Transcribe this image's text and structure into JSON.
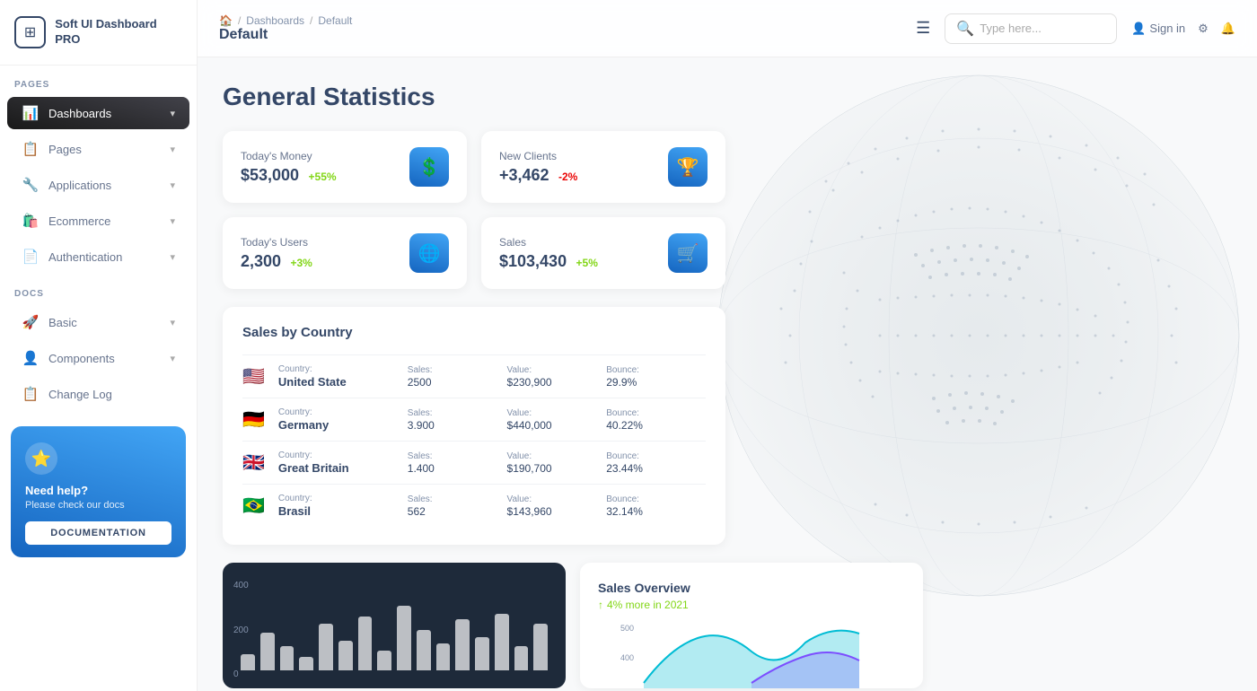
{
  "app": {
    "name": "Soft UI Dashboard PRO",
    "logo_symbol": "⊞"
  },
  "sidebar": {
    "sections": [
      {
        "label": "PAGES",
        "items": [
          {
            "id": "dashboards",
            "label": "Dashboards",
            "icon": "📊",
            "active": true,
            "has_arrow": true
          },
          {
            "id": "pages",
            "label": "Pages",
            "icon": "📋",
            "active": false,
            "has_arrow": true
          },
          {
            "id": "applications",
            "label": "Applications",
            "icon": "🔧",
            "active": false,
            "has_arrow": true
          },
          {
            "id": "ecommerce",
            "label": "Ecommerce",
            "icon": "🛍️",
            "active": false,
            "has_arrow": true
          },
          {
            "id": "authentication",
            "label": "Authentication",
            "icon": "📄",
            "active": false,
            "has_arrow": true
          }
        ]
      },
      {
        "label": "DOCS",
        "items": [
          {
            "id": "basic",
            "label": "Basic",
            "icon": "🚀",
            "active": false,
            "has_arrow": true
          },
          {
            "id": "components",
            "label": "Components",
            "icon": "👤",
            "active": false,
            "has_arrow": true
          },
          {
            "id": "changelog",
            "label": "Change Log",
            "icon": "📋",
            "active": false,
            "has_arrow": false
          }
        ]
      }
    ],
    "help": {
      "title": "Need help?",
      "subtitle": "Please check our docs",
      "button_label": "DOCUMENTATION"
    }
  },
  "topbar": {
    "breadcrumb": {
      "home_icon": "🏠",
      "items": [
        "Dashboards",
        "Default"
      ]
    },
    "current_page": "Default",
    "search_placeholder": "Type here...",
    "actions": {
      "signin_label": "Sign in",
      "settings_icon": "⚙",
      "bell_icon": "🔔"
    }
  },
  "main": {
    "title": "General Statistics",
    "stats": [
      {
        "label": "Today's Money",
        "value": "$53,000",
        "change": "+55%",
        "change_type": "pos",
        "icon": "💲"
      },
      {
        "label": "New Clients",
        "value": "+3,462",
        "change": "-2%",
        "change_type": "neg",
        "icon": "🏆"
      },
      {
        "label": "Today's Users",
        "value": "2,300",
        "change": "+3%",
        "change_type": "pos",
        "icon": "🌐"
      },
      {
        "label": "Sales",
        "value": "$103,430",
        "change": "+5%",
        "change_type": "pos",
        "icon": "🛒"
      }
    ],
    "sales_by_country": {
      "title": "Sales by Country",
      "columns": [
        "Country:",
        "Sales:",
        "Value:",
        "Bounce:"
      ],
      "rows": [
        {
          "flag": "🇺🇸",
          "country": "United State",
          "sales": "2500",
          "value": "$230,900",
          "bounce": "29.9%"
        },
        {
          "flag": "🇩🇪",
          "country": "Germany",
          "sales": "3.900",
          "value": "$440,000",
          "bounce": "40.22%"
        },
        {
          "flag": "🇬🇧",
          "country": "Great Britain",
          "sales": "1.400",
          "value": "$190,700",
          "bounce": "23.44%"
        },
        {
          "flag": "🇧🇷",
          "country": "Brasil",
          "sales": "562",
          "value": "$143,960",
          "bounce": "32.14%"
        }
      ]
    },
    "bar_chart": {
      "y_labels": [
        "400",
        "200",
        "0"
      ],
      "bars": [
        12,
        28,
        18,
        10,
        35,
        22,
        40,
        15,
        48,
        30,
        20,
        38,
        25,
        42,
        18,
        35
      ]
    },
    "sales_overview": {
      "title": "Sales Overview",
      "subtitle": "4% more in 2021",
      "y_labels": [
        "500",
        "400"
      ]
    }
  }
}
